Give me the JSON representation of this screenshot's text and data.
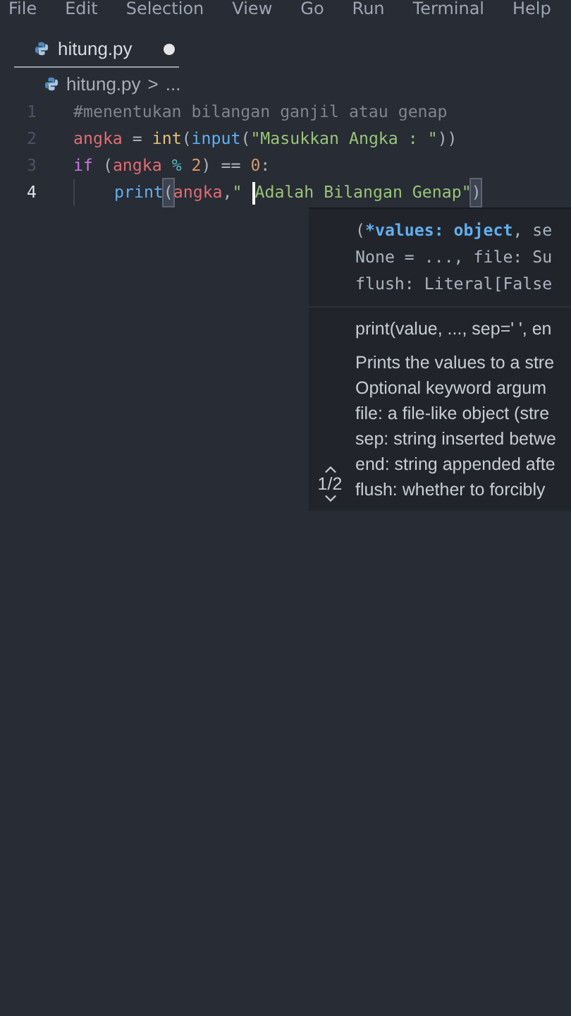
{
  "menu": [
    "File",
    "Edit",
    "Selection",
    "View",
    "Go",
    "Run",
    "Terminal",
    "Help"
  ],
  "tabs": [
    {
      "label": "hitung.py",
      "selected": true,
      "modified": true
    }
  ],
  "breadcrumb": {
    "file": "hitung.py",
    "separator": ">",
    "rest": "..."
  },
  "editor": {
    "lines": [
      {
        "number": "1",
        "current": false,
        "indent": false,
        "tokens": [
          {
            "kind": "comment",
            "text": "#menentukan bilangan ganjil atau genap"
          }
        ]
      },
      {
        "number": "2",
        "current": false,
        "indent": false,
        "tokens": [
          {
            "kind": "variable",
            "text": "angka"
          },
          {
            "kind": "plain",
            "text": " = "
          },
          {
            "kind": "class",
            "text": "int"
          },
          {
            "kind": "plain",
            "text": "("
          },
          {
            "kind": "function",
            "text": "input"
          },
          {
            "kind": "plain",
            "text": "("
          },
          {
            "kind": "string",
            "text": "\"Masukkan Angka : \""
          },
          {
            "kind": "plain",
            "text": "))"
          }
        ]
      },
      {
        "number": "3",
        "current": false,
        "indent": false,
        "tokens": [
          {
            "kind": "keyword",
            "text": "if"
          },
          {
            "kind": "plain",
            "text": " ("
          },
          {
            "kind": "variable",
            "text": "angka"
          },
          {
            "kind": "operator",
            "text": " % "
          },
          {
            "kind": "number",
            "text": "2"
          },
          {
            "kind": "plain",
            "text": ") == "
          },
          {
            "kind": "number",
            "text": "0"
          },
          {
            "kind": "plain",
            "text": ":"
          }
        ]
      },
      {
        "number": "4",
        "current": true,
        "indent": true,
        "tokens": [
          {
            "kind": "function",
            "text": "print"
          },
          {
            "kind": "bracket",
            "text": "("
          },
          {
            "kind": "variable",
            "text": "angka"
          },
          {
            "kind": "plain",
            "text": ","
          },
          {
            "kind": "string",
            "text": "\" "
          },
          {
            "kind": "string",
            "text": "Adalah Bilangan Genap\"",
            "cursor": true
          },
          {
            "kind": "bracket",
            "text": ")"
          }
        ]
      }
    ]
  },
  "hover": {
    "counter": "1/2",
    "signature": [
      [
        {
          "kind": "plain",
          "text": "("
        },
        {
          "kind": "param",
          "text": "*values: object"
        },
        {
          "kind": "plain",
          "text": ", se"
        }
      ],
      [
        {
          "kind": "plain",
          "text": "None = ..., file: Su"
        }
      ],
      [
        {
          "kind": "plain",
          "text": "flush: Literal[False"
        }
      ]
    ],
    "usage": "print(value, ..., sep=' ', en",
    "doc": [
      "Prints the values to a stre",
      "Optional keyword argum",
      "file: a file-like object (stre",
      "sep: string inserted betwe",
      "end: string appended afte",
      "flush: whether to forcibly"
    ]
  }
}
